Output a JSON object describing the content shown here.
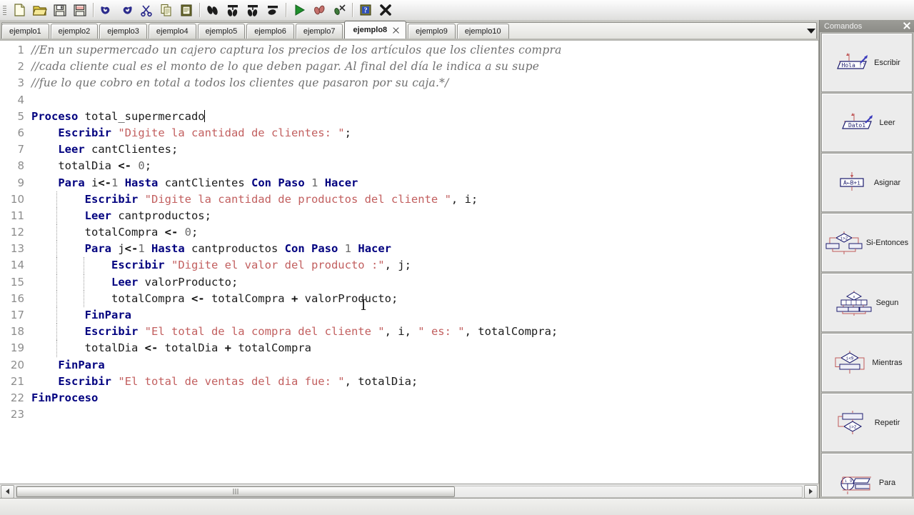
{
  "toolbar": {
    "buttons": [
      {
        "name": "new-file-button",
        "icon": "page-icon",
        "title": "Nuevo"
      },
      {
        "name": "open-file-button",
        "icon": "open-folder-icon",
        "title": "Abrir"
      },
      {
        "name": "save-file-button",
        "icon": "floppy-disk-icon",
        "title": "Guardar"
      },
      {
        "name": "save-all-button",
        "icon": "floppy-disk-red-icon",
        "title": "Guardar todo"
      },
      {
        "name": "undo-button",
        "icon": "undo-arrow-icon",
        "title": "Deshacer"
      },
      {
        "name": "redo-button",
        "icon": "redo-arrow-icon",
        "title": "Rehacer"
      },
      {
        "name": "cut-button",
        "icon": "scissors-icon",
        "title": "Cortar"
      },
      {
        "name": "copy-button",
        "icon": "copy-pages-icon",
        "title": "Copiar"
      },
      {
        "name": "paste-button",
        "icon": "clipboard-icon",
        "title": "Pegar"
      },
      {
        "name": "indent-button",
        "icon": "footprints-icon",
        "title": "Indentar"
      },
      {
        "name": "flowchart-button",
        "icon": "flowchart-icon",
        "title": "Diagrama de flujo"
      },
      {
        "name": "nassi-button",
        "icon": "nassi-icon",
        "title": "Diagrama Nassi"
      },
      {
        "name": "pseudocode-button",
        "icon": "pseudocode-icon",
        "title": "Pseudocodigo"
      },
      {
        "name": "run-button",
        "icon": "play-triangle-icon",
        "title": "Ejecutar"
      },
      {
        "name": "debug-button",
        "icon": "debug-icon",
        "title": "Ejecutar paso a paso"
      },
      {
        "name": "stop-button",
        "icon": "stop-debug-icon",
        "title": "Detener"
      },
      {
        "name": "help-button",
        "icon": "help-book-icon",
        "title": "Ayuda"
      },
      {
        "name": "close-button",
        "icon": "black-x-icon",
        "title": "Cerrar"
      }
    ]
  },
  "tabs": {
    "items": [
      {
        "label": "ejemplo1",
        "active": false
      },
      {
        "label": "ejemplo2",
        "active": false
      },
      {
        "label": "ejemplo3",
        "active": false
      },
      {
        "label": "ejemplo4",
        "active": false
      },
      {
        "label": "ejemplo5",
        "active": false
      },
      {
        "label": "ejemplo6",
        "active": false
      },
      {
        "label": "ejemplo7",
        "active": false
      },
      {
        "label": "ejemplo8",
        "active": true
      },
      {
        "label": "ejemplo9",
        "active": false
      },
      {
        "label": "ejemplo10",
        "active": false
      }
    ]
  },
  "editor": {
    "lines": [
      {
        "num": "1",
        "indent": 0,
        "tokens": [
          {
            "t": "cm",
            "v": "//En un supermercado un cajero captura los precios de los artículos que los clientes compra"
          }
        ]
      },
      {
        "num": "2",
        "indent": 0,
        "tokens": [
          {
            "t": "cm",
            "v": "//cada cliente cual es el monto de lo que deben pagar. Al final del día le indica a su supe"
          }
        ]
      },
      {
        "num": "3",
        "indent": 0,
        "tokens": [
          {
            "t": "cm",
            "v": "//fue lo que cobro en total a todos los clientes que pasaron por su caja.*/"
          }
        ]
      },
      {
        "num": "4",
        "indent": 0,
        "tokens": []
      },
      {
        "num": "5",
        "indent": 0,
        "tokens": [
          {
            "t": "k",
            "v": "Proceso"
          },
          {
            "t": "id",
            "v": " total_supermercado"
          },
          {
            "t": "caret",
            "v": ""
          }
        ]
      },
      {
        "num": "6",
        "indent": 0,
        "tokens": [
          {
            "t": "id",
            "v": "    "
          },
          {
            "t": "k",
            "v": "Escribir"
          },
          {
            "t": "id",
            "v": " "
          },
          {
            "t": "s",
            "v": "\"Digite la cantidad de clientes: \""
          },
          {
            "t": "id",
            "v": ";"
          }
        ]
      },
      {
        "num": "7",
        "indent": 0,
        "tokens": [
          {
            "t": "id",
            "v": "    "
          },
          {
            "t": "k",
            "v": "Leer"
          },
          {
            "t": "id",
            "v": " cantClientes;"
          }
        ]
      },
      {
        "num": "8",
        "indent": 0,
        "tokens": [
          {
            "t": "id",
            "v": "    totalDia "
          },
          {
            "t": "op",
            "v": "<-"
          },
          {
            "t": "id",
            "v": " "
          },
          {
            "t": "n",
            "v": "0"
          },
          {
            "t": "id",
            "v": ";"
          }
        ]
      },
      {
        "num": "9",
        "indent": 0,
        "tokens": [
          {
            "t": "id",
            "v": "    "
          },
          {
            "t": "k",
            "v": "Para"
          },
          {
            "t": "id",
            "v": " i"
          },
          {
            "t": "op",
            "v": "<-"
          },
          {
            "t": "n",
            "v": "1"
          },
          {
            "t": "id",
            "v": " "
          },
          {
            "t": "k",
            "v": "Hasta"
          },
          {
            "t": "id",
            "v": " cantClientes "
          },
          {
            "t": "k",
            "v": "Con Paso"
          },
          {
            "t": "id",
            "v": " "
          },
          {
            "t": "n",
            "v": "1"
          },
          {
            "t": "id",
            "v": " "
          },
          {
            "t": "k",
            "v": "Hacer"
          }
        ]
      },
      {
        "num": "10",
        "indent": 1,
        "tokens": [
          {
            "t": "id",
            "v": "        "
          },
          {
            "t": "k",
            "v": "Escribir"
          },
          {
            "t": "id",
            "v": " "
          },
          {
            "t": "s",
            "v": "\"Digite la cantidad de productos del cliente \""
          },
          {
            "t": "id",
            "v": ", i;"
          }
        ]
      },
      {
        "num": "11",
        "indent": 1,
        "tokens": [
          {
            "t": "id",
            "v": "        "
          },
          {
            "t": "k",
            "v": "Leer"
          },
          {
            "t": "id",
            "v": " cantproductos;"
          }
        ]
      },
      {
        "num": "12",
        "indent": 1,
        "tokens": [
          {
            "t": "id",
            "v": "        totalCompra "
          },
          {
            "t": "op",
            "v": "<-"
          },
          {
            "t": "id",
            "v": " "
          },
          {
            "t": "n",
            "v": "0"
          },
          {
            "t": "id",
            "v": ";"
          }
        ]
      },
      {
        "num": "13",
        "indent": 1,
        "tokens": [
          {
            "t": "id",
            "v": "        "
          },
          {
            "t": "k",
            "v": "Para"
          },
          {
            "t": "id",
            "v": " j"
          },
          {
            "t": "op",
            "v": "<-"
          },
          {
            "t": "n",
            "v": "1"
          },
          {
            "t": "id",
            "v": " "
          },
          {
            "t": "k",
            "v": "Hasta"
          },
          {
            "t": "id",
            "v": " cantproductos "
          },
          {
            "t": "k",
            "v": "Con Paso"
          },
          {
            "t": "id",
            "v": " "
          },
          {
            "t": "n",
            "v": "1"
          },
          {
            "t": "id",
            "v": " "
          },
          {
            "t": "k",
            "v": "Hacer"
          }
        ]
      },
      {
        "num": "14",
        "indent": 2,
        "tokens": [
          {
            "t": "id",
            "v": "            "
          },
          {
            "t": "k",
            "v": "Escribir"
          },
          {
            "t": "id",
            "v": " "
          },
          {
            "t": "s",
            "v": "\"Digite el valor del producto :\""
          },
          {
            "t": "id",
            "v": ", j;"
          }
        ]
      },
      {
        "num": "15",
        "indent": 2,
        "tokens": [
          {
            "t": "id",
            "v": "            "
          },
          {
            "t": "k",
            "v": "Leer"
          },
          {
            "t": "id",
            "v": " valorProducto;"
          }
        ]
      },
      {
        "num": "16",
        "indent": 2,
        "tokens": [
          {
            "t": "id",
            "v": "            totalCompra "
          },
          {
            "t": "op",
            "v": "<-"
          },
          {
            "t": "id",
            "v": " totalCompra "
          },
          {
            "t": "op",
            "v": "+"
          },
          {
            "t": "id",
            "v": " valorProducto;"
          }
        ]
      },
      {
        "num": "17",
        "indent": 1,
        "tokens": [
          {
            "t": "id",
            "v": "        "
          },
          {
            "t": "k",
            "v": "FinPara"
          }
        ]
      },
      {
        "num": "18",
        "indent": 1,
        "tokens": [
          {
            "t": "id",
            "v": "        "
          },
          {
            "t": "k",
            "v": "Escribir"
          },
          {
            "t": "id",
            "v": " "
          },
          {
            "t": "s",
            "v": "\"El total de la compra del cliente \""
          },
          {
            "t": "id",
            "v": ", i, "
          },
          {
            "t": "s",
            "v": "\" es: \""
          },
          {
            "t": "id",
            "v": ", totalCompra;"
          }
        ]
      },
      {
        "num": "19",
        "indent": 1,
        "tokens": [
          {
            "t": "id",
            "v": "        totalDia "
          },
          {
            "t": "op",
            "v": "<-"
          },
          {
            "t": "id",
            "v": " totalDia "
          },
          {
            "t": "op",
            "v": "+"
          },
          {
            "t": "id",
            "v": " totalCompra"
          }
        ]
      },
      {
        "num": "20",
        "indent": 0,
        "tokens": [
          {
            "t": "id",
            "v": "    "
          },
          {
            "t": "k",
            "v": "FinPara"
          }
        ]
      },
      {
        "num": "21",
        "indent": 0,
        "tokens": [
          {
            "t": "id",
            "v": "    "
          },
          {
            "t": "k",
            "v": "Escribir"
          },
          {
            "t": "id",
            "v": " "
          },
          {
            "t": "s",
            "v": "\"El total de ventas del dia fue: \""
          },
          {
            "t": "id",
            "v": ", totalDia;"
          }
        ]
      },
      {
        "num": "22",
        "indent": 0,
        "tokens": [
          {
            "t": "k",
            "v": "FinProceso"
          }
        ]
      },
      {
        "num": "23",
        "indent": 0,
        "tokens": []
      }
    ],
    "colors": {
      "keyword": "#00007f",
      "string": "#c25f5f",
      "number": "#6a6a6a",
      "comment": "#707070",
      "identifier": "#1b1b1b",
      "gutter": "#8c8c8c",
      "background": "#ffffff"
    }
  },
  "commands_panel": {
    "title": "Comandos",
    "close_icon": "close-x-icon",
    "items": [
      {
        "label": "Escribir",
        "icon": "escribir-parallelogram-icon",
        "icon_text": "'Hola !'"
      },
      {
        "label": "Leer",
        "icon": "leer-parallelogram-icon",
        "icon_text": "Dato1"
      },
      {
        "label": "Asignar",
        "icon": "asignar-box-icon",
        "icon_text": "A←B+i"
      },
      {
        "label": "Si-Entonces",
        "icon": "si-entonces-diamond-icon",
        "icon_text": ""
      },
      {
        "label": "Segun",
        "icon": "segun-multibranch-icon",
        "icon_text": ""
      },
      {
        "label": "Mientras",
        "icon": "mientras-loop-icon",
        "icon_text": ""
      },
      {
        "label": "Repetir",
        "icon": "repetir-loop-icon",
        "icon_text": ""
      },
      {
        "label": "Para",
        "icon": "para-loop-icon",
        "icon_text": ""
      }
    ]
  },
  "scrollbar": {
    "left_arrow_icon": "arrow-left-icon",
    "right_arrow_icon": "arrow-right-icon"
  }
}
